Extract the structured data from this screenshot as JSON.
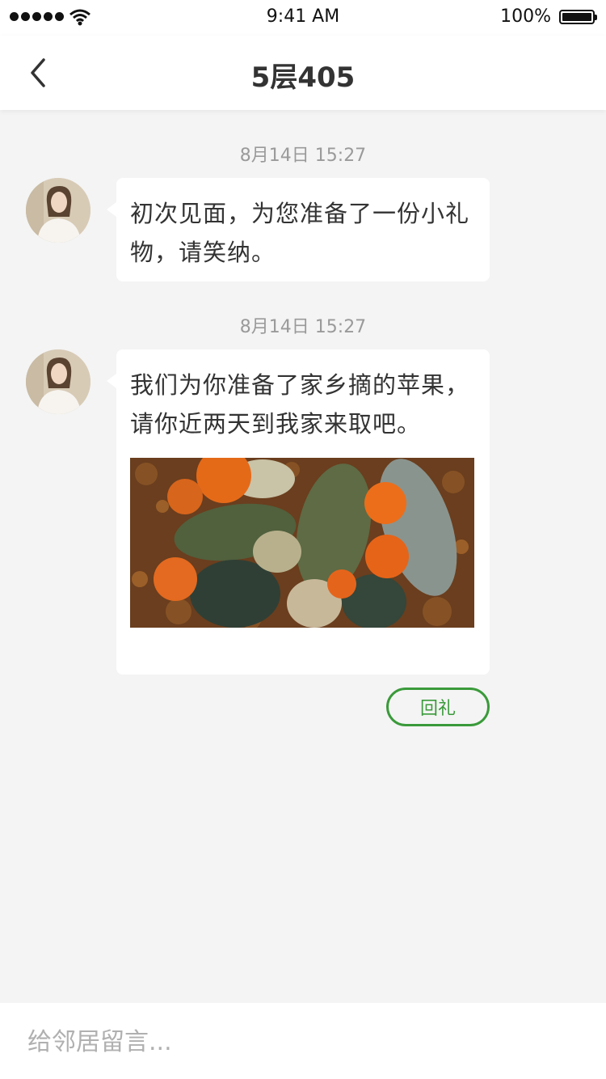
{
  "status_bar": {
    "time": "9:41 AM",
    "battery": "100%",
    "signal_icon": "signal-dots-icon",
    "wifi_icon": "wifi-icon",
    "battery_icon": "battery-icon"
  },
  "nav": {
    "title": "5层405",
    "back_icon": "chevron-left-icon"
  },
  "messages": [
    {
      "timestamp": "8月14日 15:27",
      "text": "初次见面，为您准备了一份小礼物，请笑纳。",
      "has_image": false
    },
    {
      "timestamp": "8月14日 15:27",
      "text": "我们为你准备了家乡摘的苹果，请你近两天到我家来取吧。",
      "has_image": true,
      "image_icon": "pumpkins-photo"
    }
  ],
  "actions": {
    "return_gift_label": "回礼"
  },
  "input": {
    "placeholder": "给邻居留言..."
  },
  "colors": {
    "accent": "#3a9a3a",
    "background": "#f4f4f4",
    "bubble": "#ffffff"
  }
}
